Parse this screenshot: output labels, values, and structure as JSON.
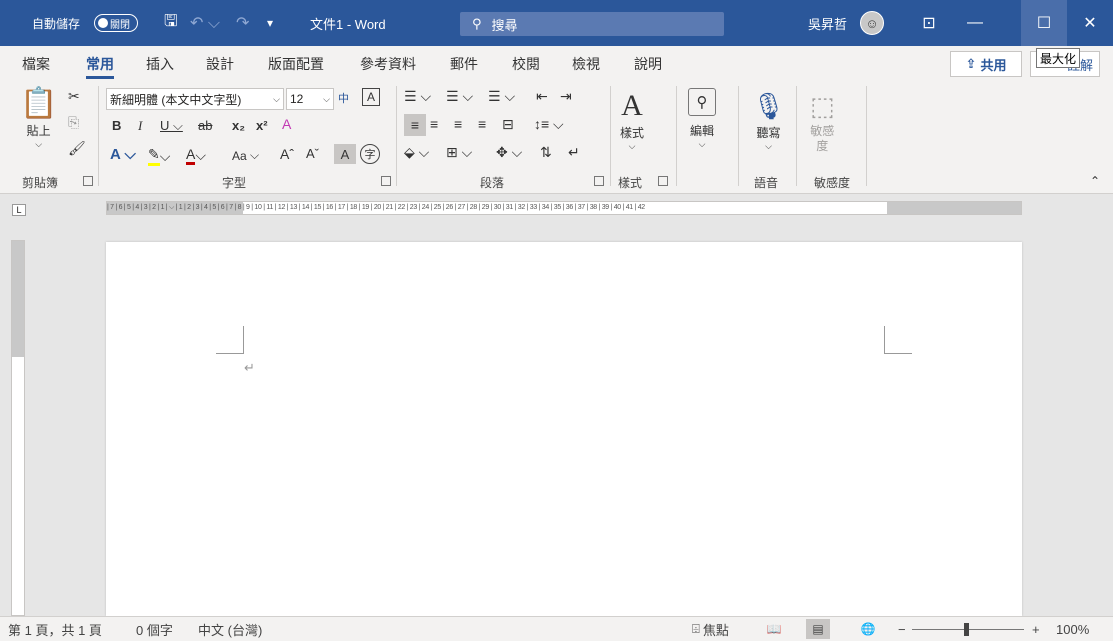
{
  "titlebar": {
    "autosave_label": "自動儲存",
    "autosave_state": "關閉",
    "doc_title": "文件1 - Word",
    "search_placeholder": "搜尋",
    "user_name": "吳昇哲"
  },
  "tabs": [
    "檔案",
    "常用",
    "插入",
    "設計",
    "版面配置",
    "參考資料",
    "郵件",
    "校閱",
    "檢視",
    "說明"
  ],
  "active_tab": "常用",
  "share_label": "共用",
  "comment_label": "註解",
  "tooltip": "最大化",
  "ribbon": {
    "clipboard": {
      "paste": "貼上",
      "group": "剪貼簿"
    },
    "font": {
      "name": "新細明體 (本文中文字型)",
      "size": "12",
      "group": "字型",
      "case_label": "Aa"
    },
    "paragraph": {
      "group": "段落"
    },
    "styles": {
      "label": "樣式",
      "group": "樣式"
    },
    "editing": {
      "label": "編輯"
    },
    "voice": {
      "label": "聽寫",
      "group": "語音"
    },
    "sensitivity": {
      "label": "敏感度",
      "group": "敏感度"
    }
  },
  "ruler_text": "| 7 | 6 | 5 | 4 | 3 | 2 | 1 | ⌵ | 1 | 2 | 3 | 4 | 5 | 6 | 7 | 8 | 9 | 10 | 11 | 12 | 13 | 14 | 15 | 16 | 17 | 18 | 19 | 20 | 21 | 22 | 23 | 24 | 25 | 26 | 27 | 28 | 29 | 30 | 31 | 32 | 33 | 34 | 35 | 36 | 37 | 38 | 39 | 40 | 41 | 42",
  "status": {
    "page": "第 1 頁，共 1 頁",
    "words": "0 個字",
    "language": "中文 (台灣)",
    "focus": "焦點",
    "zoom": "100%"
  }
}
